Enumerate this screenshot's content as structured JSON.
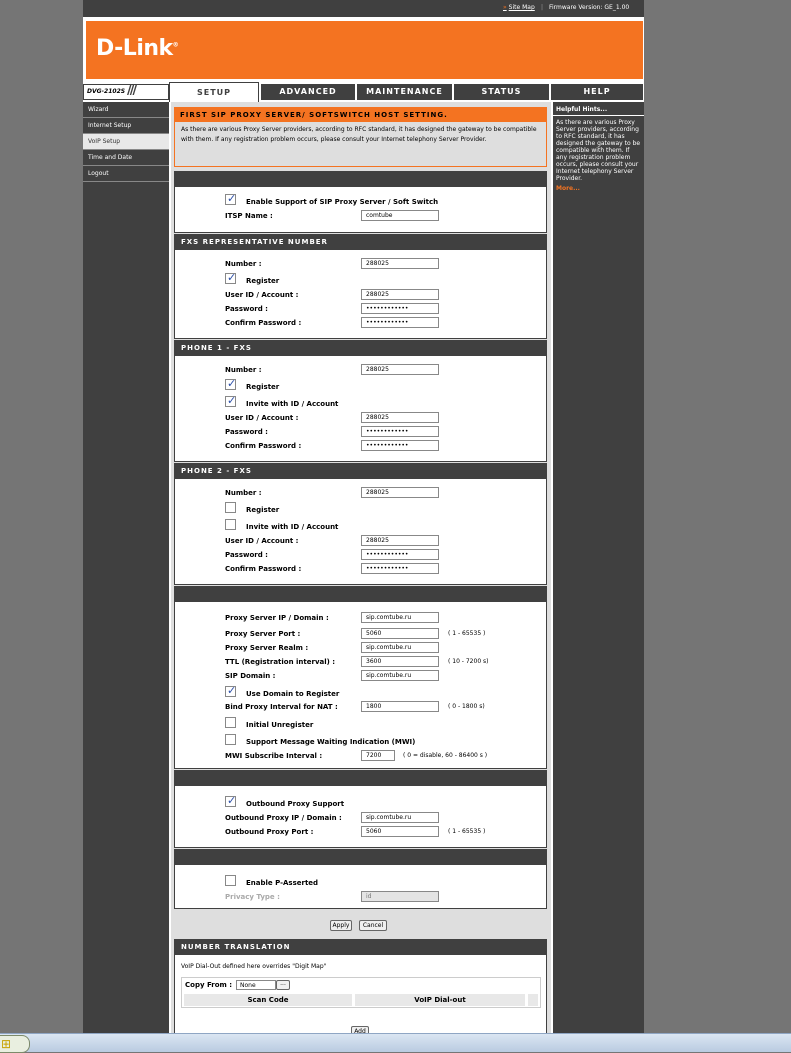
{
  "topbar": {
    "site_map": "Site Map",
    "firmware": "Firmware Version: GE_1.00"
  },
  "brand": {
    "logo": "D-Link",
    "model": "DVG-2102S"
  },
  "tabs": [
    {
      "label": "SETUP"
    },
    {
      "label": "ADVANCED"
    },
    {
      "label": "MAINTENANCE"
    },
    {
      "label": "STATUS"
    },
    {
      "label": "HELP"
    }
  ],
  "sidebar": {
    "items": [
      {
        "label": "Wizard"
      },
      {
        "label": "Internet Setup"
      },
      {
        "label": "VoIP Setup"
      },
      {
        "label": "Time and Date"
      },
      {
        "label": "Logout"
      }
    ]
  },
  "hints": {
    "title": "Helpful Hints...",
    "text": "As there are various Proxy Server providers, according to RFC standard, it has designed the gateway to be compatible with them. If any registration problem occurs, please consult your Internet telephony Server Provider.",
    "more": "More..."
  },
  "intro": {
    "title": "FIRST SIP PROXY SERVER/ SOFTSWITCH HOST SETTING.",
    "text": "As there are various Proxy Server providers, according to RFC standard, it has designed the gateway to be compatible with them. If any registration problem occurs, please consult your Internet telephony Server Provider."
  },
  "sip": {
    "enable_label": "Enable Support of SIP Proxy Server / Soft Switch",
    "itsp_label": "ITSP Name :",
    "itsp_value": "comtube"
  },
  "fxs": {
    "title": "FXS REPRESENTATIVE NUMBER",
    "number_label": "Number :",
    "number": "288025",
    "register_label": "Register",
    "userid_label": "User ID / Account :",
    "userid": "288025",
    "password_label": "Password :",
    "password": "••••••••••••",
    "confirm_label": "Confirm Password :",
    "confirm": "••••••••••••"
  },
  "phone1": {
    "title": "PHONE 1 - FXS",
    "number_label": "Number :",
    "number": "288025",
    "register_label": "Register",
    "invite_label": "Invite with ID / Account",
    "userid_label": "User ID / Account :",
    "userid": "288025",
    "password_label": "Password :",
    "password": "••••••••••••",
    "confirm_label": "Confirm Password :",
    "confirm": "••••••••••••"
  },
  "phone2": {
    "title": "PHONE 2 - FXS",
    "number_label": "Number :",
    "number": "288025",
    "register_label": "Register",
    "invite_label": "Invite with ID / Account",
    "userid_label": "User ID / Account :",
    "userid": "288025",
    "password_label": "Password :",
    "password": "••••••••••••",
    "confirm_label": "Confirm Password :",
    "confirm": "••••••••••••"
  },
  "proxy": {
    "ip_label": "Proxy Server IP / Domain :",
    "ip": "sip.comtube.ru",
    "port_label": "Proxy Server Port :",
    "port": "5060",
    "port_hint": "( 1 - 65535 )",
    "realm_label": "Proxy Server Realm :",
    "realm": "sip.comtube.ru",
    "ttl_label": "TTL (Registration interval) :",
    "ttl": "3600",
    "ttl_hint": "( 10 - 7200 s)",
    "domain_label": "SIP Domain :",
    "domain": "sip.comtube.ru",
    "use_domain_label": "Use Domain to Register",
    "bind_label": "Bind Proxy Interval for NAT :",
    "bind": "1800",
    "bind_hint": "( 0 - 1800 s)",
    "unreg_label": "Initial Unregister",
    "mwi_label": "Support Message Waiting Indication (MWI)",
    "mwi_int_label": "MWI Subscribe Interval :",
    "mwi_int": "7200",
    "mwi_hint": "( 0 = disable, 60 - 86400 s )"
  },
  "outbound": {
    "support_label": "Outbound Proxy Support",
    "ip_label": "Outbound Proxy IP / Domain :",
    "ip": "sip.comtube.ru",
    "port_label": "Outbound Proxy Port :",
    "port": "5060",
    "port_hint": "( 1 - 65535 )"
  },
  "passerted": {
    "enable_label": "Enable P-Asserted",
    "type_label": "Privacy Type :",
    "type": "id"
  },
  "buttons": {
    "apply": "Apply",
    "cancel": "Cancel",
    "add": "Add"
  },
  "translation": {
    "title": "NUMBER TRANSLATION",
    "note": "VoIP Dial-Out defined here overrides \"Digit Map\"",
    "copy_label": "Copy From :",
    "copy_value": "None",
    "col_scan": "Scan Code",
    "col_dialout": "VoIP Dial-out"
  }
}
